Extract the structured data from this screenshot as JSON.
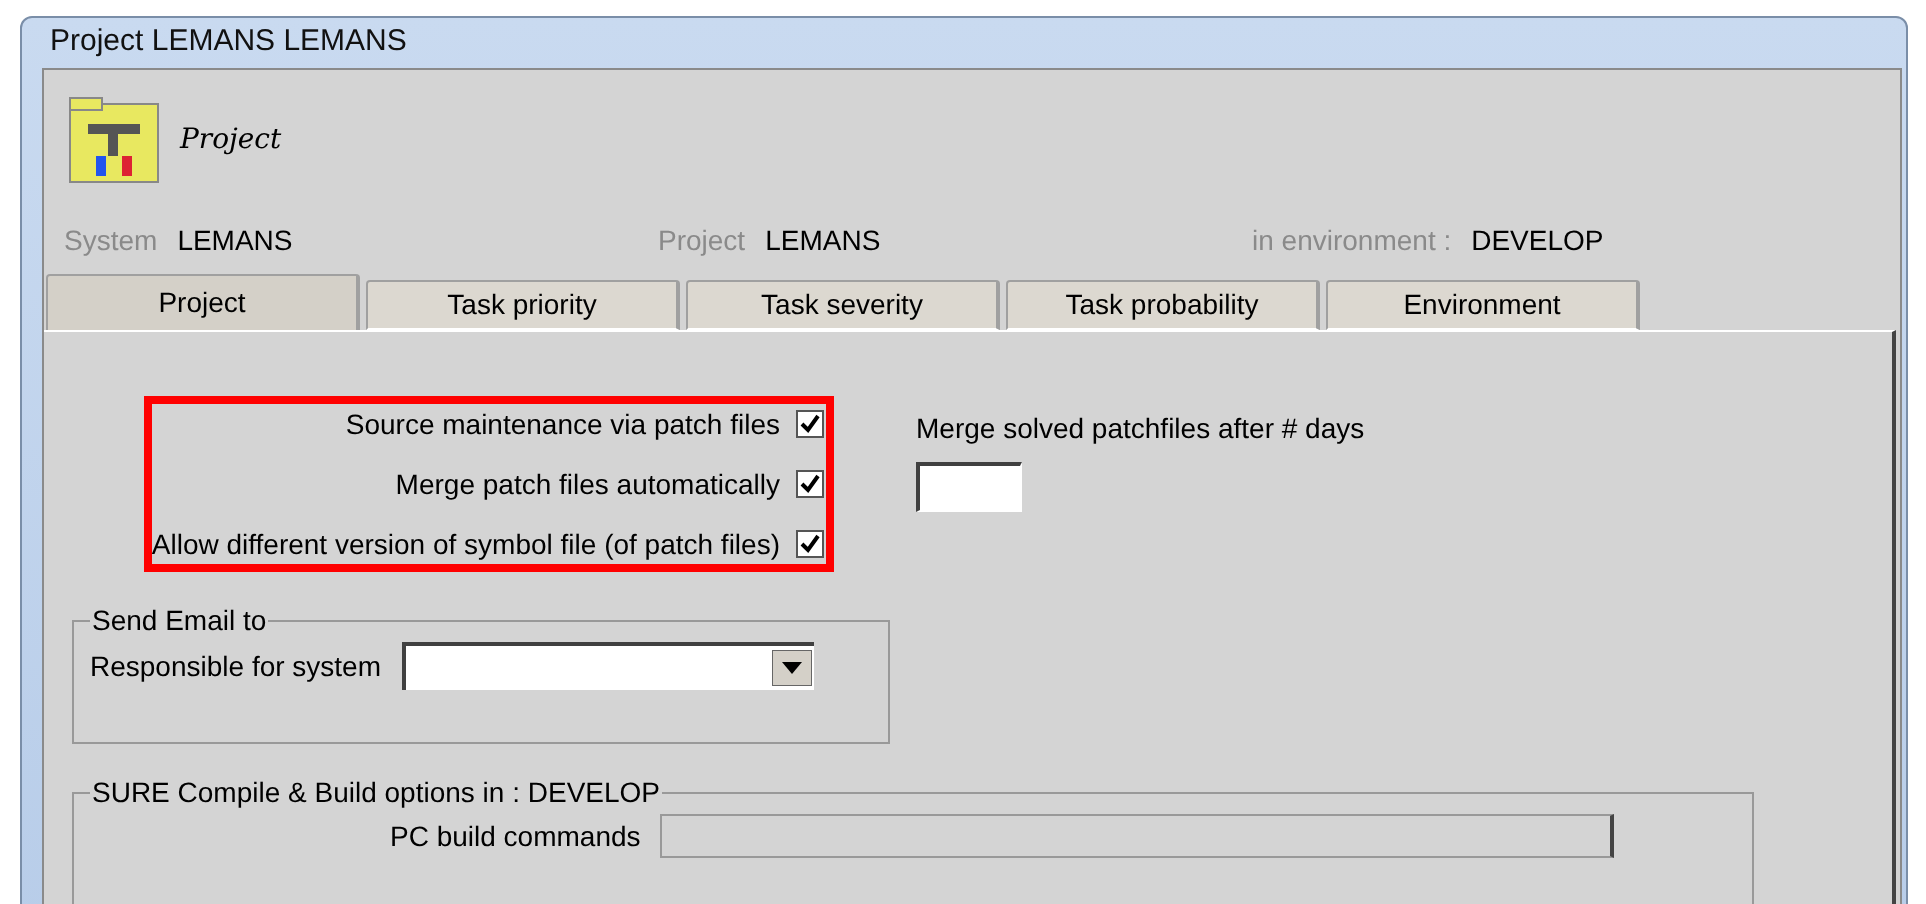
{
  "window": {
    "title": "Project LEMANS LEMANS"
  },
  "header": {
    "caption": "Project"
  },
  "info": [
    {
      "label": "System",
      "value": "LEMANS"
    },
    {
      "label": "Project",
      "value": "LEMANS"
    },
    {
      "label": "in environment :",
      "value": "DEVELOP"
    }
  ],
  "tabs": [
    {
      "label": "Project",
      "selected": true
    },
    {
      "label": "Task priority",
      "selected": false
    },
    {
      "label": "Task severity",
      "selected": false
    },
    {
      "label": "Task probability",
      "selected": false
    },
    {
      "label": "Environment",
      "selected": false
    }
  ],
  "options": [
    {
      "label": "Source maintenance via patch files",
      "checked": true
    },
    {
      "label": "Merge patch files automatically",
      "checked": true
    },
    {
      "label": "Allow different version of symbol file (of patch files)",
      "checked": true
    }
  ],
  "merge_days": {
    "label": "Merge solved patchfiles after # days"
  },
  "send_email": {
    "title": "Send Email to",
    "field_label": "Responsible for system"
  },
  "build_options": {
    "title": "SURE Compile & Build options in : DEVELOP",
    "field_label": "PC build commands"
  }
}
